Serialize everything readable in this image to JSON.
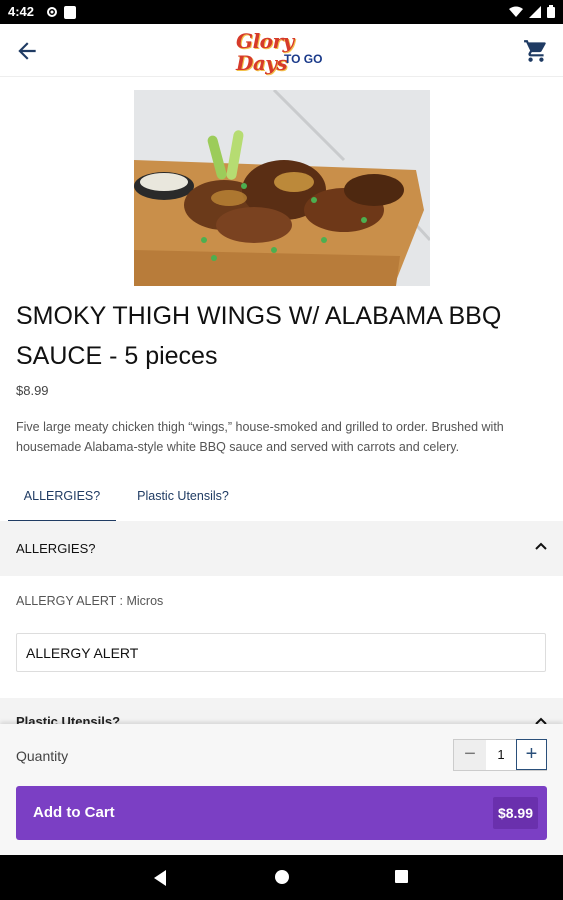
{
  "status_bar": {
    "time": "4:42",
    "icons": [
      "gear-icon",
      "square-icon",
      "wifi-icon",
      "signal-icon",
      "battery-icon"
    ]
  },
  "app_bar": {
    "logo_text": "Glory Days",
    "logo_sub": "TO GO",
    "back_icon": "arrow-left-icon",
    "cart_icon": "shopping-cart-icon"
  },
  "product": {
    "title": "SMOKY THIGH WINGS W/ ALABAMA BBQ SAUCE - 5 pieces",
    "price": "$8.99",
    "description": "Five large meaty chicken thigh “wings,” house-smoked and grilled to order. Brushed with housemade Alabama-style white BBQ sauce and served with carrots and celery."
  },
  "tabs": [
    {
      "label": "ALLERGIES?",
      "active": true
    },
    {
      "label": "Plastic Utensils?",
      "active": false
    }
  ],
  "allergies_section": {
    "header": "ALLERGIES?",
    "note": "ALLERGY ALERT : Micros",
    "option_label": "ALLERGY ALERT"
  },
  "utensils_section": {
    "header": "Plastic Utensils?"
  },
  "footer": {
    "quantity_label": "Quantity",
    "quantity_value": "1",
    "minus_symbol": "−",
    "plus_symbol": "+",
    "add_to_cart_label": "Add to Cart",
    "add_to_cart_price": "$8.99"
  },
  "colors": {
    "accent": "#7b3fc4",
    "tab_active": "#1f3b63",
    "logo_red": "#d63a2a",
    "logo_blue": "#1a3a8a"
  }
}
